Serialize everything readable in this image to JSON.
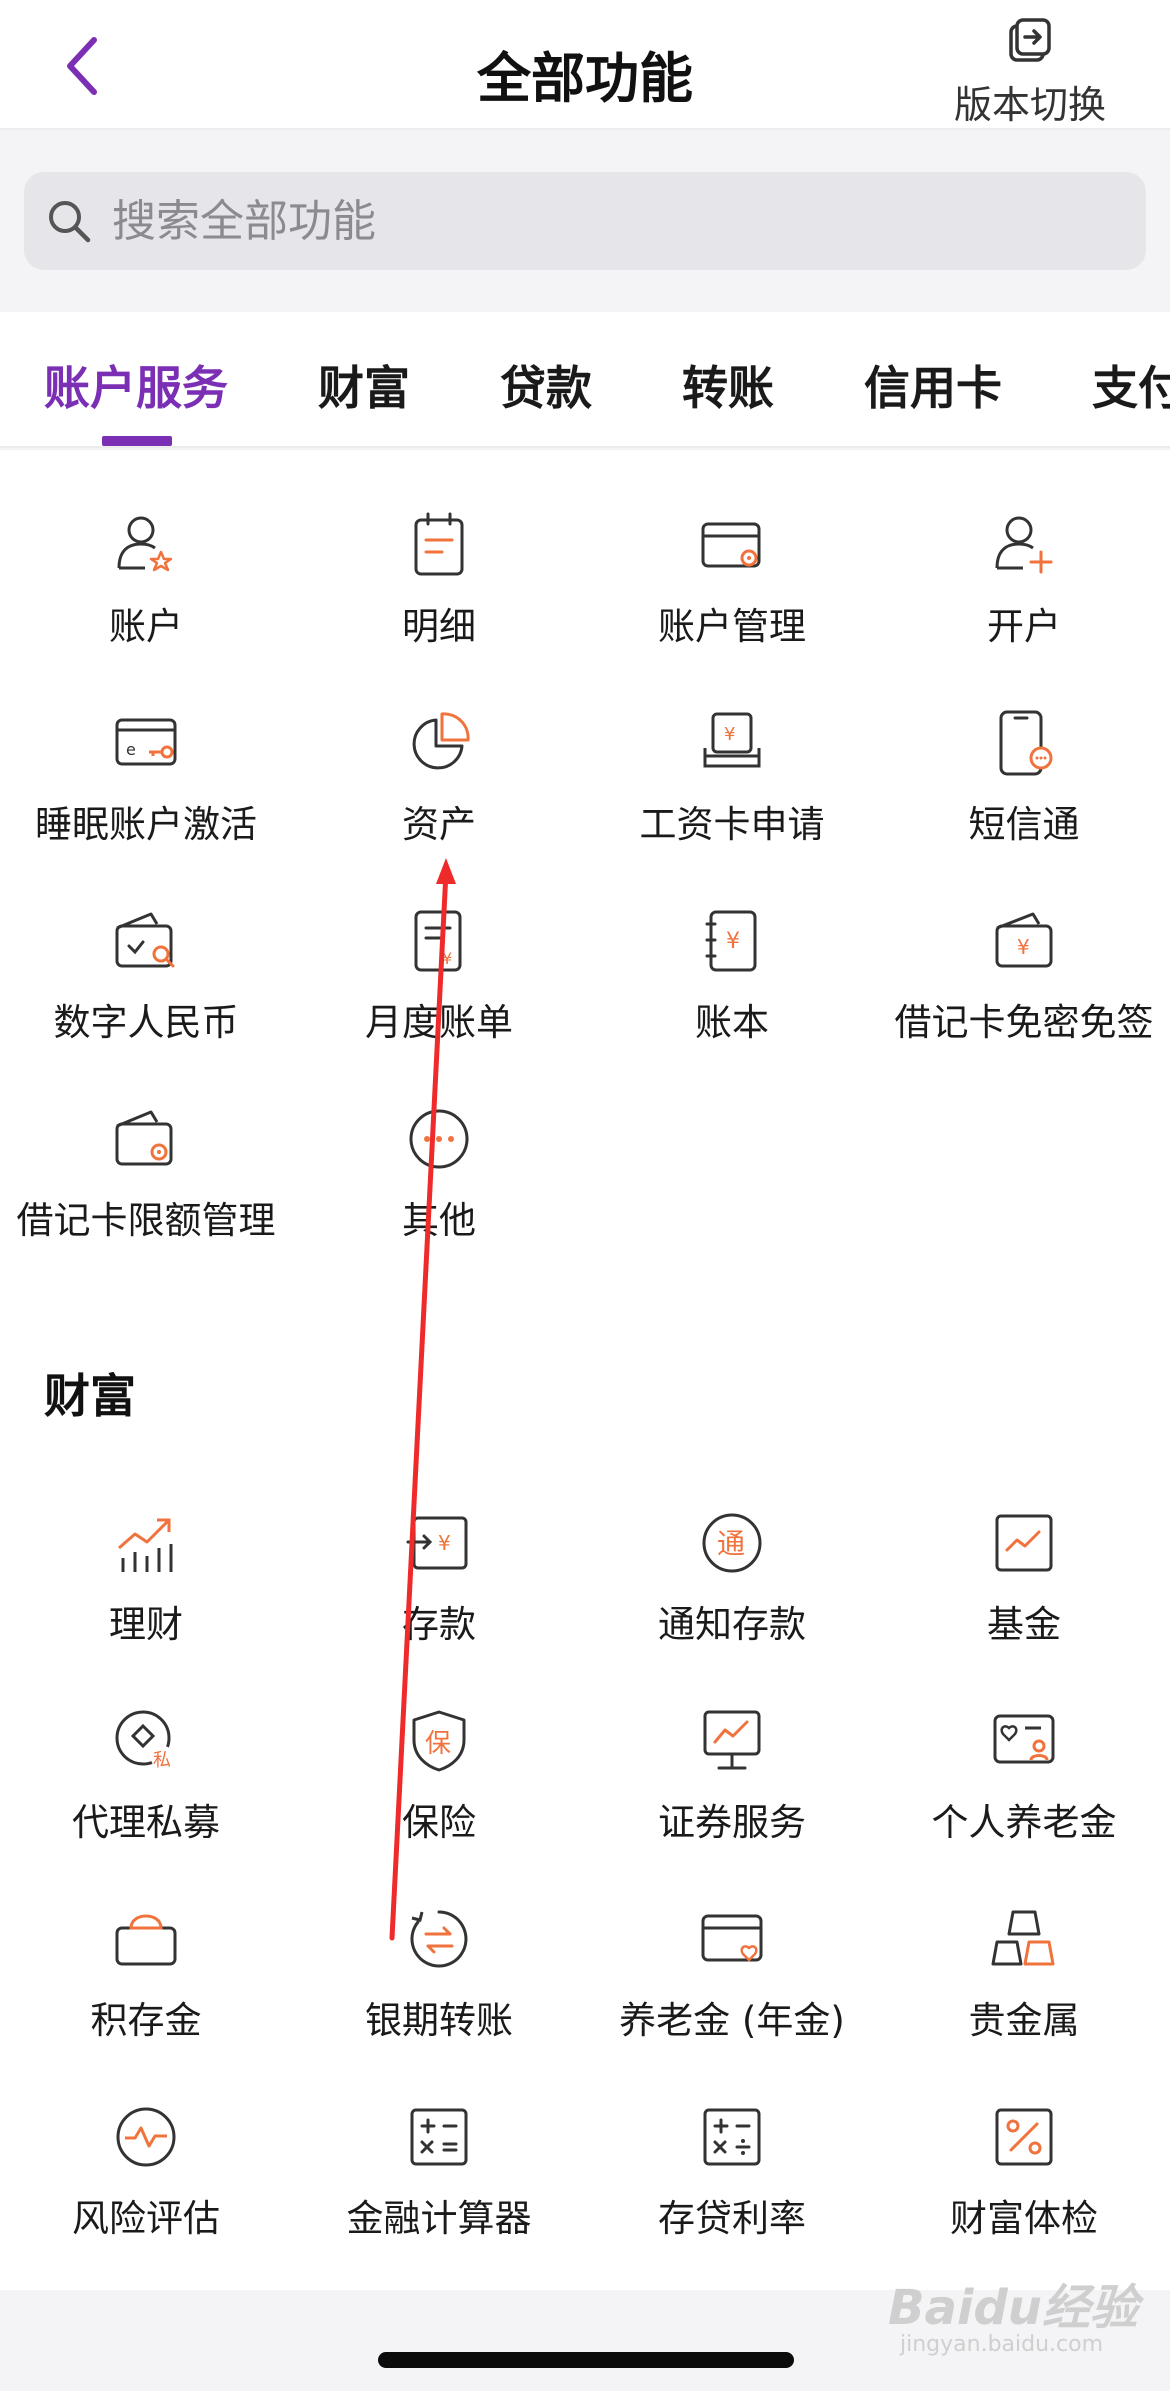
{
  "header": {
    "title": "全部功能",
    "switch_label": "版本切换"
  },
  "search": {
    "placeholder": "搜索全部功能"
  },
  "tabs": [
    "账户服务",
    "财富",
    "贷款",
    "转账",
    "信用卡",
    "支付"
  ],
  "account_items": [
    {
      "label": "账户",
      "icon": "user-star-icon"
    },
    {
      "label": "明细",
      "icon": "calendar-list-icon"
    },
    {
      "label": "账户管理",
      "icon": "card-settings-icon"
    },
    {
      "label": "开户",
      "icon": "user-add-icon"
    },
    {
      "label": "睡眠账户激活",
      "icon": "card-key-icon"
    },
    {
      "label": "资产",
      "icon": "pie-chart-icon"
    },
    {
      "label": "工资卡申请",
      "icon": "salary-card-icon"
    },
    {
      "label": "短信通",
      "icon": "phone-message-icon"
    },
    {
      "label": "数字人民币",
      "icon": "wallet-search-icon"
    },
    {
      "label": "月度账单",
      "icon": "monthly-bill-icon"
    },
    {
      "label": "账本",
      "icon": "ledger-icon"
    },
    {
      "label": "借记卡免密免签",
      "icon": "wallet-yuan-icon"
    },
    {
      "label": "借记卡限额管理",
      "icon": "wallet-settings-icon"
    },
    {
      "label": "其他",
      "icon": "more-circle-icon"
    }
  ],
  "wealth": {
    "title": "财富",
    "items": [
      {
        "label": "理财",
        "icon": "chart-up-icon"
      },
      {
        "label": "存款",
        "icon": "deposit-icon"
      },
      {
        "label": "通知存款",
        "icon": "notice-deposit-icon"
      },
      {
        "label": "基金",
        "icon": "fund-icon"
      },
      {
        "label": "代理私募",
        "icon": "private-fund-icon"
      },
      {
        "label": "保险",
        "icon": "shield-icon"
      },
      {
        "label": "证券服务",
        "icon": "securities-icon"
      },
      {
        "label": "个人养老金",
        "icon": "pension-card-icon"
      },
      {
        "label": "积存金",
        "icon": "gold-box-icon"
      },
      {
        "label": "银期转账",
        "icon": "exchange-icon"
      },
      {
        "label": "养老金 (年金)",
        "icon": "annuity-card-icon"
      },
      {
        "label": "贵金属",
        "icon": "gold-bars-icon"
      },
      {
        "label": "风险评估",
        "icon": "risk-pulse-icon"
      },
      {
        "label": "金融计算器",
        "icon": "calculator-icon"
      },
      {
        "label": "存贷利率",
        "icon": "rate-calculator-icon"
      },
      {
        "label": "财富体检",
        "icon": "percent-icon"
      }
    ]
  },
  "colors": {
    "accent": "#7b2fb5",
    "icon_orange": "#f0723c",
    "icon_stroke": "#333333"
  },
  "watermark": {
    "text": "Baidu经验",
    "url_text": "jingyan.baidu.com"
  }
}
